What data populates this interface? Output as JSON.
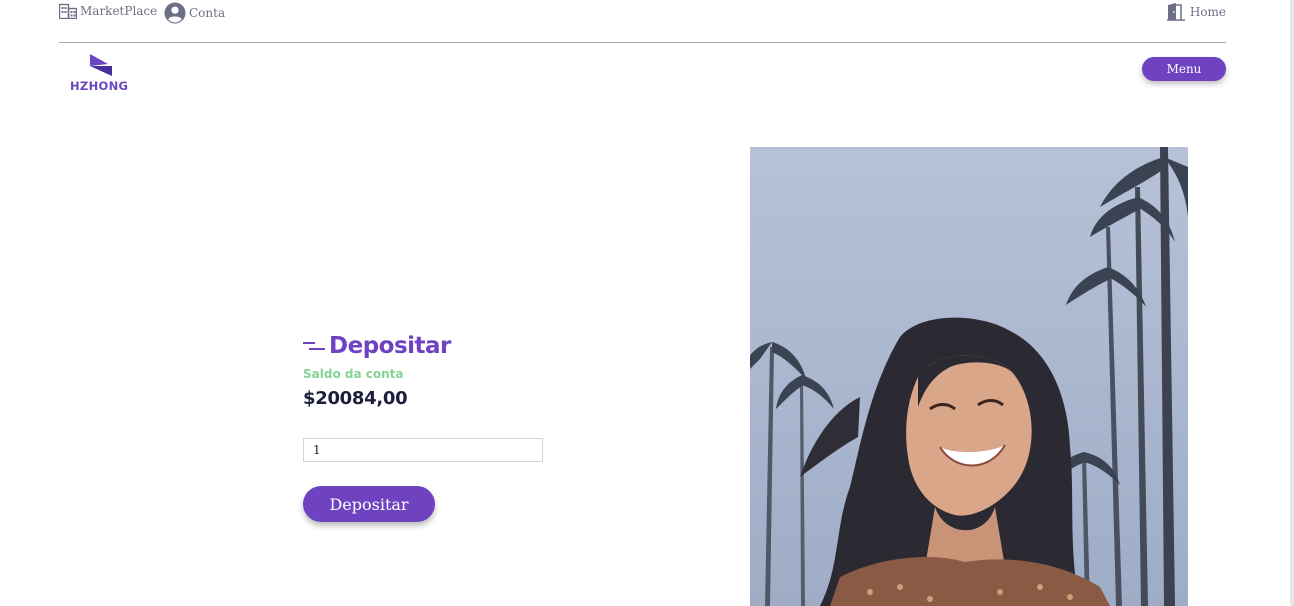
{
  "topbar": {
    "marketplace_label": "MarketPlace",
    "conta_label": "Conta",
    "home_label": "Home"
  },
  "header": {
    "logo_text": "HZHONG",
    "menu_label": "Menu"
  },
  "deposit": {
    "title": "Depositar",
    "balance_label": "Saldo da conta",
    "balance_value": "$20084,00",
    "amount_value": "1",
    "button_label": "Depositar"
  },
  "colors": {
    "accent": "#6f42c1",
    "balance_label": "#86d394",
    "text_dark": "#1b1f3b"
  },
  "icons": {
    "marketplace": "building-icon",
    "conta": "user-circle-icon",
    "home": "door-exit-icon"
  }
}
